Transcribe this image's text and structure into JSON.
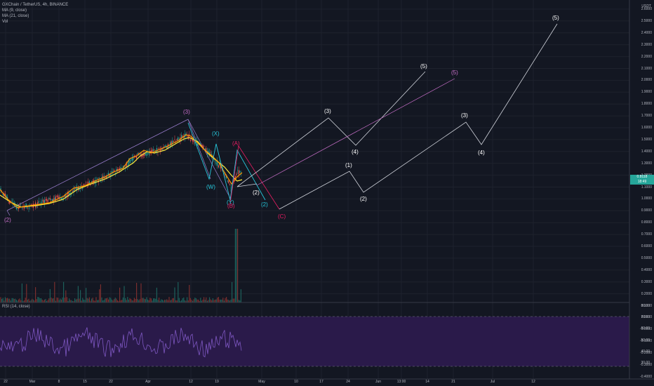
{
  "header": {
    "symbol_line": "GXChain / TetherUS, 4h, BINANCE",
    "indicators": [
      "MA (9, close)",
      "MA (21, close)",
      "Vol"
    ],
    "rsi_label": "RSI (14, close)"
  },
  "price_axis": {
    "currency": "USDT",
    "ticks": [
      "2.6000",
      "2.5000",
      "2.4000",
      "2.3000",
      "2.2000",
      "2.1000",
      "2.0000",
      "1.9000",
      "1.8000",
      "1.7000",
      "1.6000",
      "1.5000",
      "1.4000",
      "1.3000",
      "1.2000",
      "1.1000",
      "1.0000",
      "0.9000",
      "0.8000",
      "0.7000",
      "0.6000",
      "0.5000",
      "0.4000",
      "0.3000",
      "0.2000",
      "0.1000",
      "0.0000",
      "-0.0000",
      "-0.1000",
      "-0.2000",
      "-0.3000",
      "-0.4000"
    ],
    "current_price": "0.8118",
    "countdown": "18:49"
  },
  "rsi_axis": {
    "ticks": [
      "80.00",
      "70.00",
      "60.00",
      "50.00",
      "40.00",
      "30.00"
    ]
  },
  "time_axis": {
    "ticks": [
      "22",
      "Mar",
      "8",
      "15",
      "22",
      "Apr",
      "12",
      "19",
      "May",
      "10",
      "17",
      "24",
      "Jun",
      "13:00",
      "14",
      "21",
      "Jul",
      "12"
    ]
  },
  "wave_labels": [
    {
      "text": "(2)",
      "color": "#c86fc9"
    },
    {
      "text": "(3)",
      "color": "#c86fc9"
    },
    {
      "text": "(X)",
      "color": "#26c6da"
    },
    {
      "text": "(W)",
      "color": "#26c6da"
    },
    {
      "text": "(Y)",
      "color": "#26c6da"
    },
    {
      "text": "(B)",
      "color": "#e91e63"
    },
    {
      "text": "(A)",
      "color": "#e91e63"
    },
    {
      "text": "(2)",
      "color": "#ffffff"
    },
    {
      "text": "(2)",
      "color": "#26c6da"
    },
    {
      "text": "(C)",
      "color": "#e91e63"
    },
    {
      "text": "(3)",
      "color": "#ffffff"
    },
    {
      "text": "(4)",
      "color": "#ffffff"
    },
    {
      "text": "(5)",
      "color": "#ffffff"
    },
    {
      "text": "(5)",
      "color": "#c86fc9"
    },
    {
      "text": "(1)",
      "color": "#ffffff"
    },
    {
      "text": "(2)",
      "color": "#ffffff"
    },
    {
      "text": "(3)",
      "color": "#ffffff"
    },
    {
      "text": "(4)",
      "color": "#ffffff"
    },
    {
      "text": "(5)",
      "color": "#ffffff"
    }
  ],
  "colors": {
    "background": "#131722",
    "grid": "#1e222d",
    "rsi_band": "#2a1a4a",
    "rsi_line": "#7e57c2",
    "ma_fast": "#ff9800",
    "ma_slow": "#ffeb3b",
    "price_badge": "#26a69a"
  }
}
